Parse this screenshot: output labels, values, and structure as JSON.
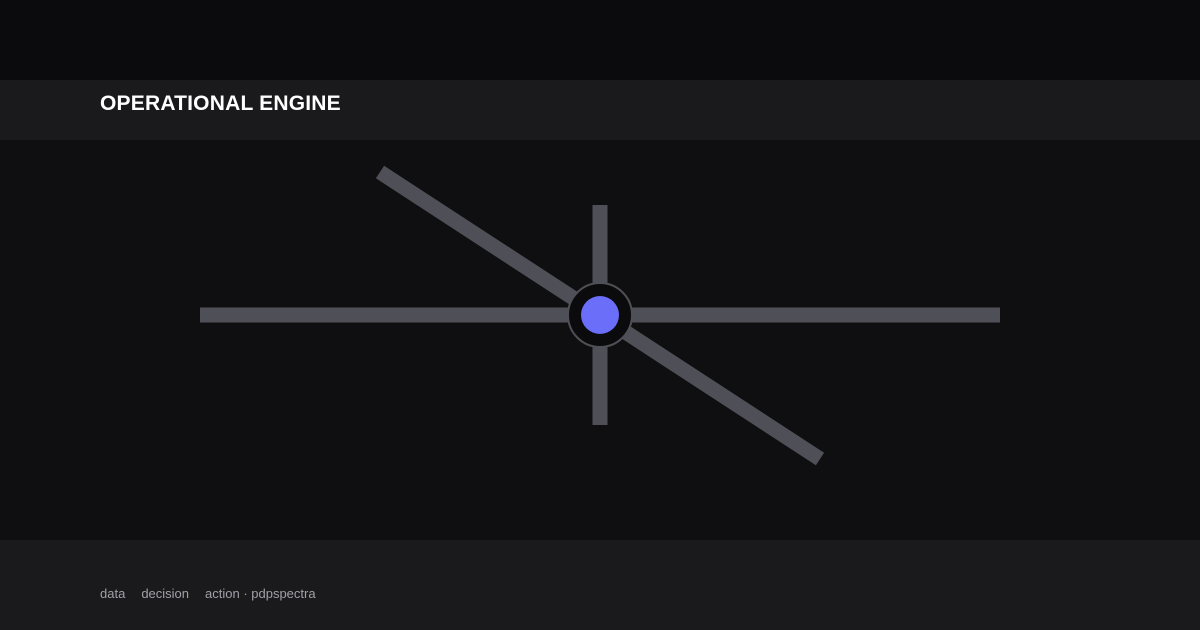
{
  "header": {
    "title": "OPERATIONAL ENGINE"
  },
  "footer": {
    "item_1": "data",
    "item_2": "decision",
    "item_3": "action · pdpspectra"
  },
  "colors": {
    "accent": "#6b6ef8",
    "line": "#4f4f57",
    "background": "#0f0f11",
    "band": "#1a1a1c"
  }
}
